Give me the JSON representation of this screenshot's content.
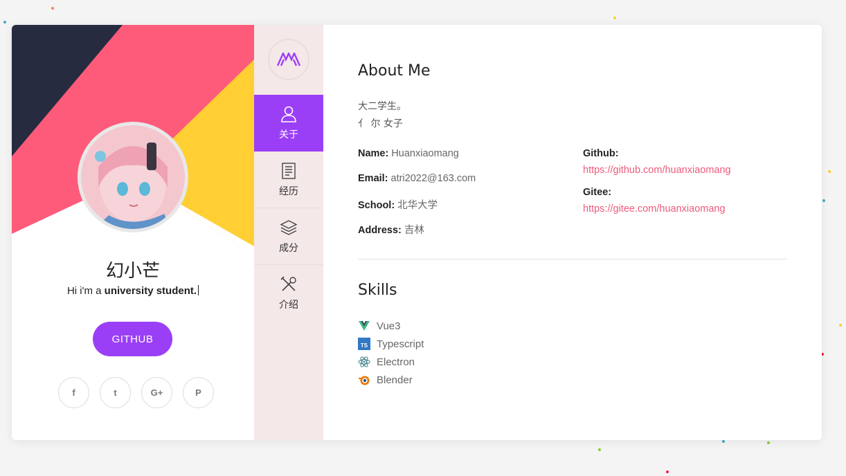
{
  "profile": {
    "name": "幻小芒",
    "tagline_prefix": "Hi i'm a ",
    "tagline_bold": "university student.",
    "github_button": "GITHUB",
    "socials": [
      {
        "icon": "facebook-icon",
        "glyph": "f"
      },
      {
        "icon": "twitter-icon",
        "glyph": "t"
      },
      {
        "icon": "google-plus-icon",
        "glyph": "G+"
      },
      {
        "icon": "pinterest-icon",
        "glyph": "P"
      }
    ]
  },
  "nav": {
    "items": [
      {
        "label": "关于",
        "icon": "user-icon",
        "active": true
      },
      {
        "label": "经历",
        "icon": "document-icon",
        "active": false
      },
      {
        "label": "成分",
        "icon": "layers-icon",
        "active": false
      },
      {
        "label": "介绍",
        "icon": "tools-icon",
        "active": false
      }
    ]
  },
  "about": {
    "title": "About Me",
    "bio_line1": "大二学生。",
    "bio_line2": "亻 尔 女子",
    "name_label": "Name:",
    "name_value": "Huanxiaomang",
    "email_label": "Email:",
    "email_value": "atri2022@163.com",
    "school_label": "School:",
    "school_value": "北华大学",
    "address_label": "Address:",
    "address_value": "吉林",
    "github_label": "Github:",
    "github_url": "https://github.com/huanxiaomang",
    "gitee_label": "Gitee:",
    "gitee_url": "https://gitee.com/huanxiaomang"
  },
  "skills": {
    "title": "Skills",
    "items": [
      {
        "label": "Vue3",
        "icon": "vue-icon"
      },
      {
        "label": "Typescript",
        "icon": "typescript-icon"
      },
      {
        "label": "Electron",
        "icon": "electron-icon"
      },
      {
        "label": "Blender",
        "icon": "blender-icon"
      }
    ]
  },
  "colors": {
    "accent": "#9b3ff7",
    "link": "#ef5a7b",
    "nav_bg": "#f5e8e8",
    "shape_dark": "#262b40",
    "shape_pink": "#fe5b7a",
    "shape_yellow": "#ffcf34"
  }
}
